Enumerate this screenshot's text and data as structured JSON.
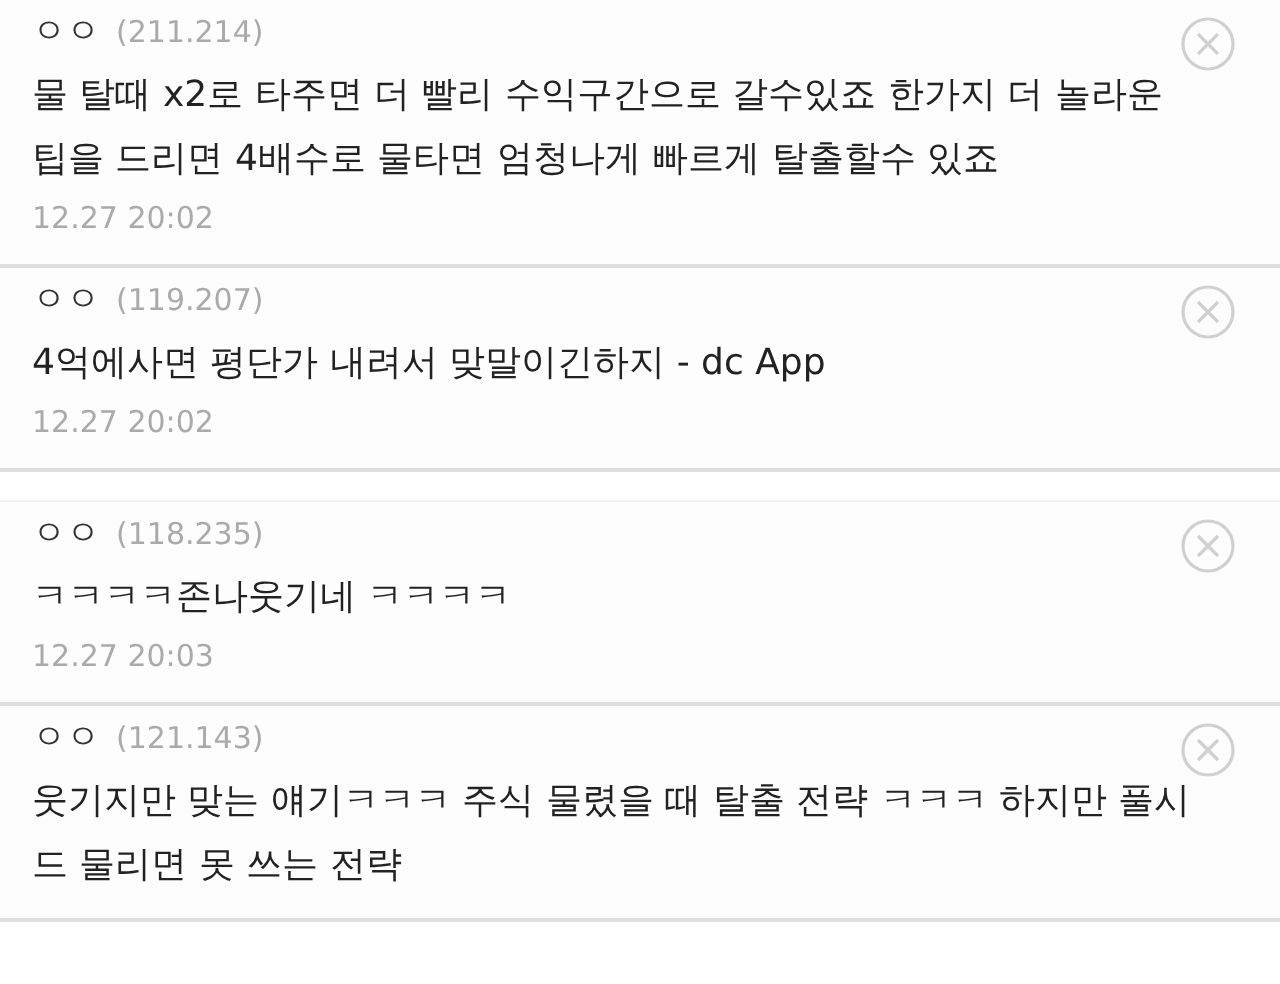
{
  "comments": [
    {
      "author": "ㅇㅇ",
      "ip": "(211.214)",
      "text": "물 탈때 x2로 타주면 더 빨리 수익구간으로 갈수있죠 한가지 더 놀라운 팁을 드리면 4배수로 물타면 엄청나게 빠르게 탈출할수 있죠",
      "date": "12.27 20:02"
    },
    {
      "author": "ㅇㅇ",
      "ip": "(119.207)",
      "text": "4억에사면 평단가 내려서 맞말이긴하지 - dc App",
      "date": "12.27 20:02"
    },
    {
      "author": "ㅇㅇ",
      "ip": "(118.235)",
      "text": "ㅋㅋㅋㅋ존나웃기네 ㅋㅋㅋㅋ",
      "date": "12.27 20:03"
    },
    {
      "author": "ㅇㅇ",
      "ip": "(121.143)",
      "text": "웃기지만 맞는 얘기ㅋㅋㅋ 주식 물렸을 때 탈출 전략 ㅋㅋㅋ 하지만 풀시드 물리면 못 쓰는 전략"
    }
  ]
}
